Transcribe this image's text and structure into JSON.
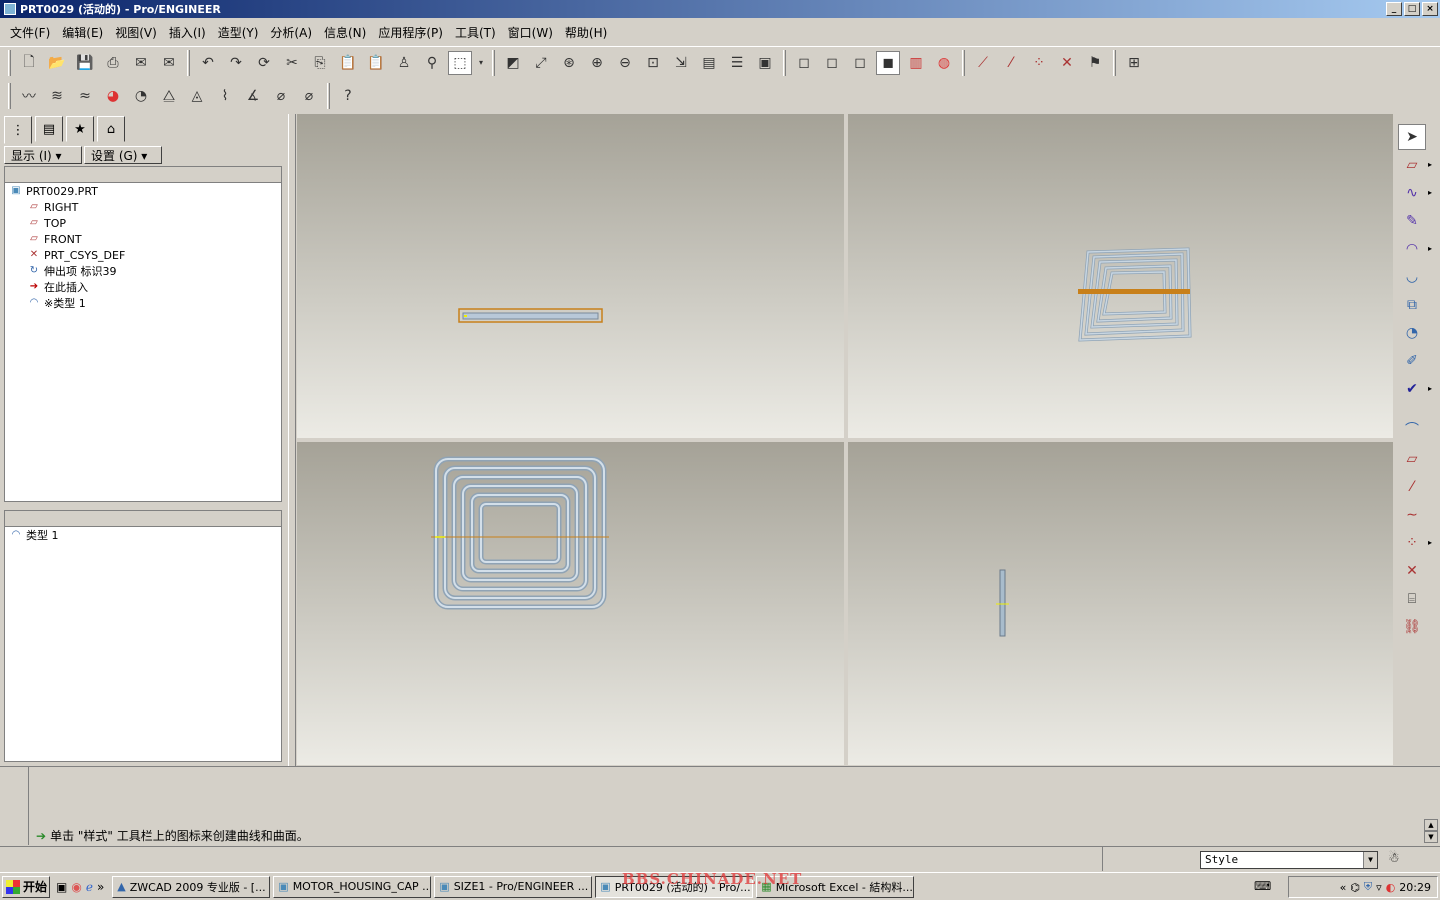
{
  "window": {
    "title": "PRT0029 (活动的) - Pro/ENGINEER",
    "buttons": [
      "_",
      "□",
      "×"
    ]
  },
  "menu": [
    "文件(F)",
    "编辑(E)",
    "视图(V)",
    "插入(I)",
    "造型(Y)",
    "分析(A)",
    "信息(N)",
    "应用程序(P)",
    "工具(T)",
    "窗口(W)",
    "帮助(H)"
  ],
  "left_panel": {
    "show_label": "显示 (I) ▾",
    "settings_label": "设置 (G) ▾",
    "tree": [
      {
        "label": "PRT0029.PRT",
        "icon": "part-icon"
      },
      {
        "label": "RIGHT",
        "icon": "datum-plane-icon"
      },
      {
        "label": "TOP",
        "icon": "datum-plane-icon"
      },
      {
        "label": "FRONT",
        "icon": "datum-plane-icon"
      },
      {
        "label": "PRT_CSYS_DEF",
        "icon": "csys-icon"
      },
      {
        "label": "伸出项 标识39",
        "icon": "sweep-icon"
      },
      {
        "label": "在此插入",
        "icon": "insert-arrow-icon"
      },
      {
        "label": "※类型 1",
        "icon": "style-feature-icon"
      }
    ],
    "sub_tree": [
      {
        "label": "类型 1",
        "icon": "style-feature-icon"
      }
    ]
  },
  "message": "单击 \"样式\" 工具栏上的图标来创建曲线和曲面。",
  "status": {
    "filter_value": "Style"
  },
  "taskbar": {
    "start": "开始",
    "tasks": [
      {
        "label": "ZWCAD 2009 专业版 - [..."
      },
      {
        "label": "MOTOR_HOUSING_CAP ..."
      },
      {
        "label": "SIZE1 - Pro/ENGINEER ..."
      },
      {
        "label": "PRT0029 (活动的) - Pro/..."
      },
      {
        "label": "Microsoft Excel - 結构料..."
      }
    ],
    "clock": "20:29"
  },
  "watermark": "BBS.CHINADE.NET",
  "colors": {
    "title_start": "#0a246a",
    "viewport_top": "#a5a297",
    "viewport_bottom": "#ecebe5",
    "coil": "#b8c8d8",
    "highlight": "#c8801a"
  }
}
